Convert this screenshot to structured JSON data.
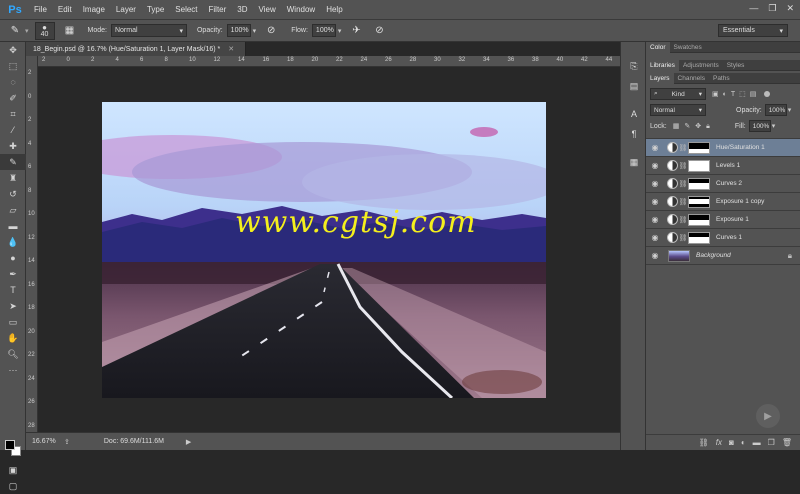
{
  "app": {
    "logo": "Ps"
  },
  "menu": [
    "File",
    "Edit",
    "Image",
    "Layer",
    "Type",
    "Select",
    "Filter",
    "3D",
    "View",
    "Window",
    "Help"
  ],
  "window_controls": [
    "—",
    "❐",
    "✕"
  ],
  "options": {
    "brush_size": "40",
    "mode_label": "Mode:",
    "mode_value": "Normal",
    "opacity_label": "Opacity:",
    "opacity_value": "100%",
    "flow_label": "Flow:",
    "flow_value": "100%",
    "workspace": "Essentials"
  },
  "document": {
    "tab_title": "18_Begin.psd @ 16.7% (Hue/Saturation 1, Layer Mask/16) *",
    "ruler_h": [
      "2",
      "0",
      "2",
      "4",
      "6",
      "8",
      "10",
      "12",
      "14",
      "16",
      "18",
      "20",
      "22",
      "24",
      "26",
      "28",
      "30",
      "32",
      "34",
      "36",
      "38",
      "40",
      "42",
      "44"
    ],
    "ruler_v": [
      "2",
      "0",
      "2",
      "4",
      "6",
      "8",
      "10",
      "12",
      "14",
      "16",
      "18",
      "20",
      "22",
      "24",
      "26",
      "28"
    ],
    "watermark": "www.cgtsj.com"
  },
  "status": {
    "zoom": "16.67%",
    "doc": "Doc: 69.6M/111.6M"
  },
  "panels": {
    "top_tabs": [
      "Color",
      "Swatches"
    ],
    "mid_tabs": [
      "Libraries",
      "Adjustments",
      "Styles"
    ],
    "layer_tabs": [
      "Layers",
      "Channels",
      "Paths"
    ],
    "filter_kind": "Kind",
    "blend_mode": "Normal",
    "opacity_label": "Opacity:",
    "opacity_value": "100%",
    "lock_label": "Lock:",
    "fill_label": "Fill:",
    "fill_value": "100%"
  },
  "layers": [
    {
      "name": "Hue/Saturation 1",
      "selected": true,
      "mask": "dark-band"
    },
    {
      "name": "Levels 1",
      "selected": false,
      "mask": "white"
    },
    {
      "name": "Curves 2",
      "selected": false,
      "mask": "dark-band"
    },
    {
      "name": "Exposure 1 copy",
      "selected": false,
      "mask": "dark-band"
    },
    {
      "name": "Exposure 1",
      "selected": false,
      "mask": "dark-band"
    },
    {
      "name": "Curves 1",
      "selected": false,
      "mask": "dark-band"
    },
    {
      "name": "Background",
      "selected": false,
      "mask": "background"
    }
  ],
  "colors": {
    "accent": "#31a8ff",
    "selected_layer": "#6d7f96",
    "watermark": "#f4ef1d"
  }
}
